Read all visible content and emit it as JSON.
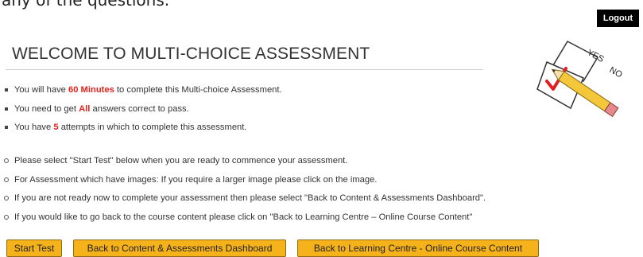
{
  "top_partial_text": "any of the questions.",
  "header": {
    "logout_label": "Logout"
  },
  "logo": {
    "icon": "yes-no-checkbox-pencil",
    "yes": "YES",
    "no": "NO"
  },
  "title": "WELCOME TO MULTI-CHOICE ASSESSMENT",
  "rules": [
    {
      "pre": "You will have ",
      "hl": "60 Minutes",
      "post": " to complete this Multi-choice Assessment."
    },
    {
      "pre": "You need to get ",
      "hl": "All",
      "post": " answers correct to pass."
    },
    {
      "pre": "You have ",
      "hl": "5",
      "post": " attempts in which to complete this assessment."
    }
  ],
  "instructions": [
    "Please select \"Start Test\" below when you are ready to commence your assessment.",
    "For Assessment which have images: If you require a larger image please click on the image.",
    "If you are not ready now to complete your assessment then please select \"Back to Content & Assessments Dashboard\".",
    "If you would like to go back to the course content please click on \"Back to Learning Centre – Online Course Content\""
  ],
  "buttons": {
    "start": "Start Test",
    "dashboard": "Back to Content & Assessments Dashboard",
    "learning": "Back to Learning Centre  - Online Course Content"
  },
  "colors": {
    "highlight": "#e4221b",
    "button": "#f6b21b",
    "logout_bg": "#000000"
  }
}
